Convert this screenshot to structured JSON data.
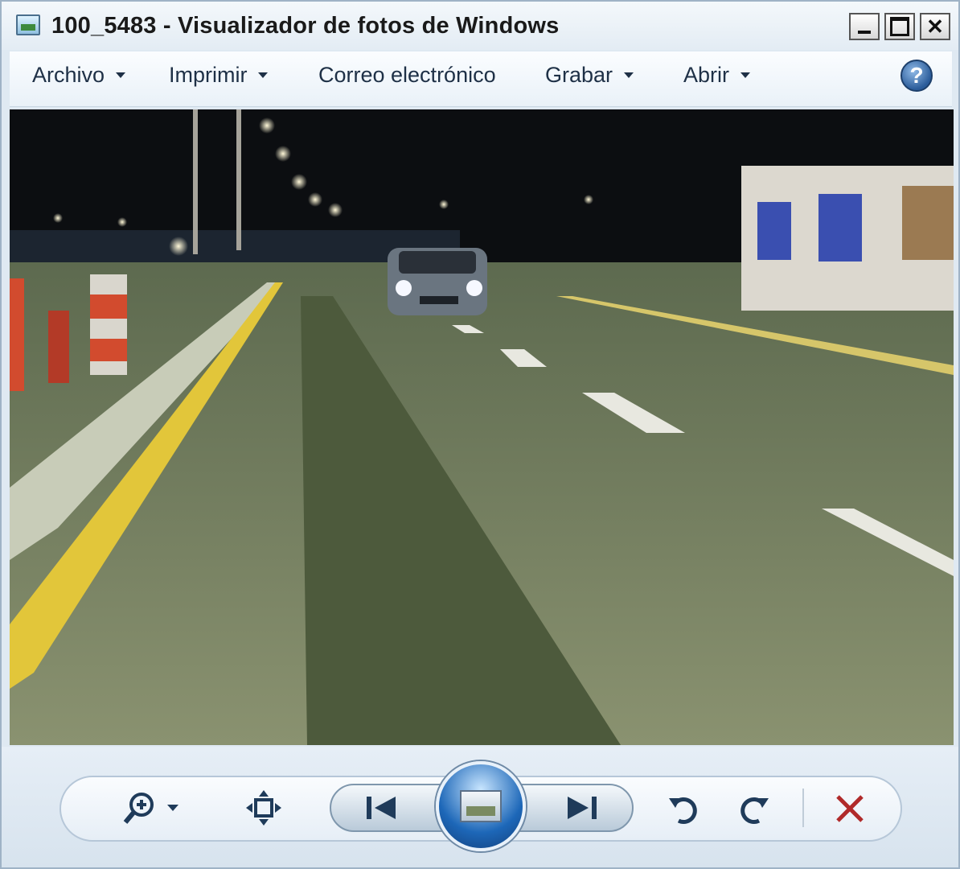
{
  "window": {
    "title": "100_5483 - Visualizador de fotos de Windows",
    "controls": {
      "minimize": "_",
      "maximize": "□",
      "close": "✕"
    }
  },
  "menu": {
    "items": [
      {
        "label": "Archivo",
        "has_dropdown": true
      },
      {
        "label": "Imprimir",
        "has_dropdown": true
      },
      {
        "label": "Correo electrónico",
        "has_dropdown": false
      },
      {
        "label": "Grabar",
        "has_dropdown": true
      },
      {
        "label": "Abrir",
        "has_dropdown": true
      }
    ],
    "help_label": "?"
  },
  "photo": {
    "description_icon": "photo-display",
    "colors": {
      "sky": "#0d0f12",
      "road": "#7a8563",
      "median": "#4f5c40",
      "yellow_line": "#e2c63a"
    }
  },
  "toolbar": {
    "icons": {
      "zoom": "zoom-icon",
      "fit": "fit-window-icon",
      "previous": "previous-icon",
      "slideshow": "slideshow-icon",
      "next": "next-icon",
      "rotate_left": "rotate-ccw-icon",
      "rotate_right": "rotate-cw-icon",
      "delete": "delete-icon"
    },
    "colors": {
      "delete": "#b02a2a",
      "slideshow": "#1d67b8"
    }
  }
}
